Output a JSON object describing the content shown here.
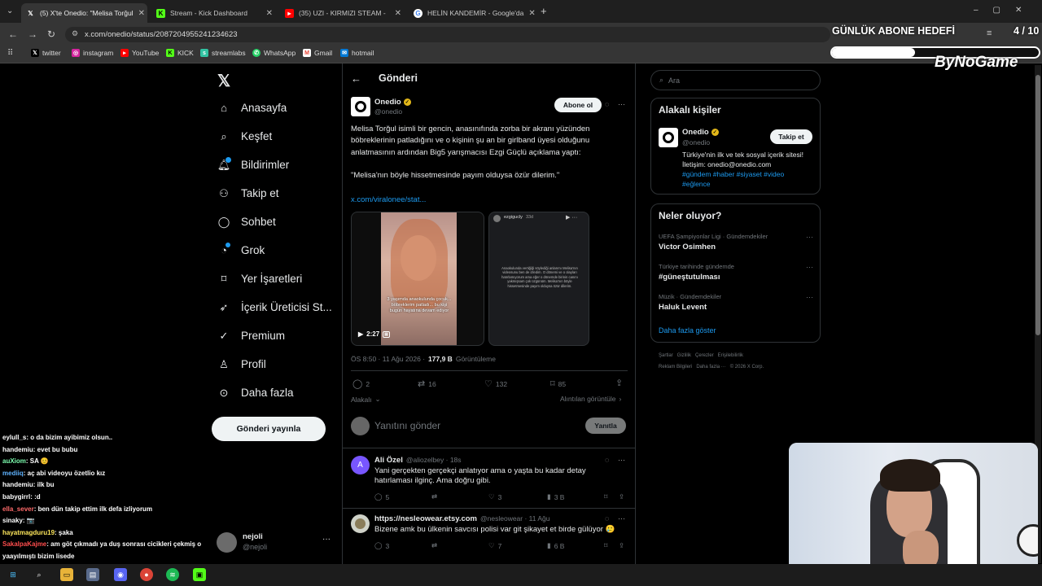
{
  "browser": {
    "tabs": [
      {
        "title": "(5) X'te Onedio: \"Melisa Torğul",
        "icon": "x-icon",
        "active": true
      },
      {
        "title": "Stream - Kick Dashboard",
        "icon": "kick-icon",
        "active": false
      },
      {
        "title": "(35) UZI - KIRMIZI STEAM -",
        "icon": "youtube-icon",
        "active": false
      },
      {
        "title": "HELİN KANDEMİR - Google'da",
        "icon": "google-icon",
        "active": false
      }
    ],
    "url": "x.com/onedio/status/2087204955241234623",
    "bookmarks": [
      "twitter",
      "instagram",
      "YouTube",
      "KICK",
      "streamlabs",
      "WhatsApp",
      "Gmail",
      "hotmail"
    ]
  },
  "overlay": {
    "goal_label": "GÜNLÜK ABONE HEDEFİ",
    "goal_count": "4 / 10",
    "goal_progress": 0.4,
    "brand": "ByNoGame"
  },
  "sidebar": {
    "items": [
      "Anasayfa",
      "Keşfet",
      "Bildirimler",
      "Takip et",
      "Sohbet",
      "Grok",
      "Yer İşaretleri",
      "İçerik Üreticisi St...",
      "Premium",
      "Profil",
      "Daha fazla"
    ],
    "post_button": "Gönderi yayınla",
    "account_name": "nejoli",
    "account_handle": "@nejoli"
  },
  "post": {
    "header": "Gönderi",
    "author_name": "Onedio",
    "author_handle": "@onedio",
    "follow_label": "Abone ol",
    "text1": "Melisa Torğul isimli bir gencin, anasınıfında zorba bir akranı yüzünden böbreklerinin patladığını ve o kişinin şu an bir girlband üyesi olduğunu anlatmasının ardından Big5 yarışmacısı Ezgi Güçlü açıklama yaptı:",
    "quote": "\"Melisa'nın böyle hissetmesinde payım olduysa özür dilerim.\"",
    "link": "x.com/viralonee/stat...",
    "video_time": "2:27",
    "video_caption": "3 yaşımda anaokulunda çocuk... böbreklerim patladı... bu kişi bugün hayatına devam ediyor",
    "story_user": "ezgigucly",
    "story_time": "33d",
    "story_text": "Anaokulunda vertiğiği söylediği anlarımı Melisa'nın videosunu ben de izledim. O dönemi ve o olayları hatırlamıyorum ama eğer o dönemde birinin canını yakmışsam çok üzgünüm. Melisa'nın böyle hissetmesinde payım olduysa özür dilerim.",
    "time_label": "ÖS 8:50 · 11 Ağu 2026 ·",
    "views_count": "177,9 B",
    "views_label": "Görüntüleme",
    "stats": {
      "replies": "2",
      "reposts": "16",
      "likes": "132",
      "bookmarks": "85"
    },
    "sort_label": "Alakalı",
    "quotes_label": "Alıntılan görüntüle",
    "reply_placeholder": "Yanıtını gönder",
    "reply_button": "Yanıtla"
  },
  "replies": [
    {
      "name": "Ali Özel",
      "handle": "@aliozelbey · 18s",
      "text": "Yani gerçekten gerçekçi anlatıyor ama o yaşta bu kadar detay hatırlaması ilginç. Ama doğru gibi.",
      "replies": "5",
      "likes": "3",
      "views": "3 B",
      "avatar_letter": "A"
    },
    {
      "name": "https://nesleowear.etsy.com",
      "handle": "@nesleowear · 11 Ağu",
      "text": "Bizene amk bu ülkenin savcısı polisi var git şikayet et birde gülüyor 🥲",
      "replies": "3",
      "likes": "7",
      "views": "6 B",
      "avatar_letter": ""
    }
  ],
  "right": {
    "search_placeholder": "Ara",
    "related_title": "Alakalı kişiler",
    "related_name": "Onedio",
    "related_handle": "@onedio",
    "related_follow": "Takip et",
    "related_bio": "Türkiye'nin ilk ve tek sosyal içerik sitesi! İletişim: onedio@onedio.com",
    "related_tags": "#gündem #haber #siyaset #video #eğlence",
    "trends_title": "Neler oluyor?",
    "trends": [
      {
        "context": "UEFA Şampiyonlar Ligi · Gündemdekiler",
        "name": "Victor Osimhen"
      },
      {
        "context": "Türkiye tarihinde gündemde",
        "name": "#güneştutulması"
      },
      {
        "context": "Müzik · Gündemdekiler",
        "name": "Haluk Levent"
      }
    ],
    "show_more": "Daha fazla göster",
    "footer1": "Şartlar   Gizlilik   Çerezler   Erişilebilirlik",
    "footer2": "Reklam Bilgileri   Daha fazla ···   © 2026 X Corp."
  },
  "chat": [
    {
      "user": "eylull_s",
      "color": "#ffffff",
      "text": ": o da bizim ayibimiz olsun.."
    },
    {
      "user": "handemiu",
      "color": "#ffffff",
      "text": ": evet bu bubu"
    },
    {
      "user": "auXiom",
      "color": "#7dffb0",
      "text": ": SA 😊"
    },
    {
      "user": "mediiq",
      "color": "#5fb3ff",
      "text": ": aç abi videoyu özetlio kız"
    },
    {
      "user": "handemiu",
      "color": "#ffffff",
      "text": ": ilk bu"
    },
    {
      "user": "babygirrl",
      "color": "#ffffff",
      "text": ": :d"
    },
    {
      "user": "ella_sever",
      "color": "#ff6a6a",
      "text": ": ben dün takip ettim ilk defa izliyorum"
    },
    {
      "user": "sinaky",
      "color": "#ffffff",
      "text": ": 📷"
    },
    {
      "user": "hayatmagduru19",
      "color": "#ffe85c",
      "text": ": şaka"
    },
    {
      "user": "SakalpaKajme",
      "color": "#ff4d4d",
      "text": ": am göt çıkmadı ya duş sonrası cicikleri çekmiş o"
    },
    {
      "user": "",
      "color": "#ffffff",
      "text": "yaayılmıştı bizim lisede"
    },
    {
      "user": "Xaratm",
      "color": "#ffffff",
      "text": ": 1 sn bile izlemedim"
    }
  ]
}
